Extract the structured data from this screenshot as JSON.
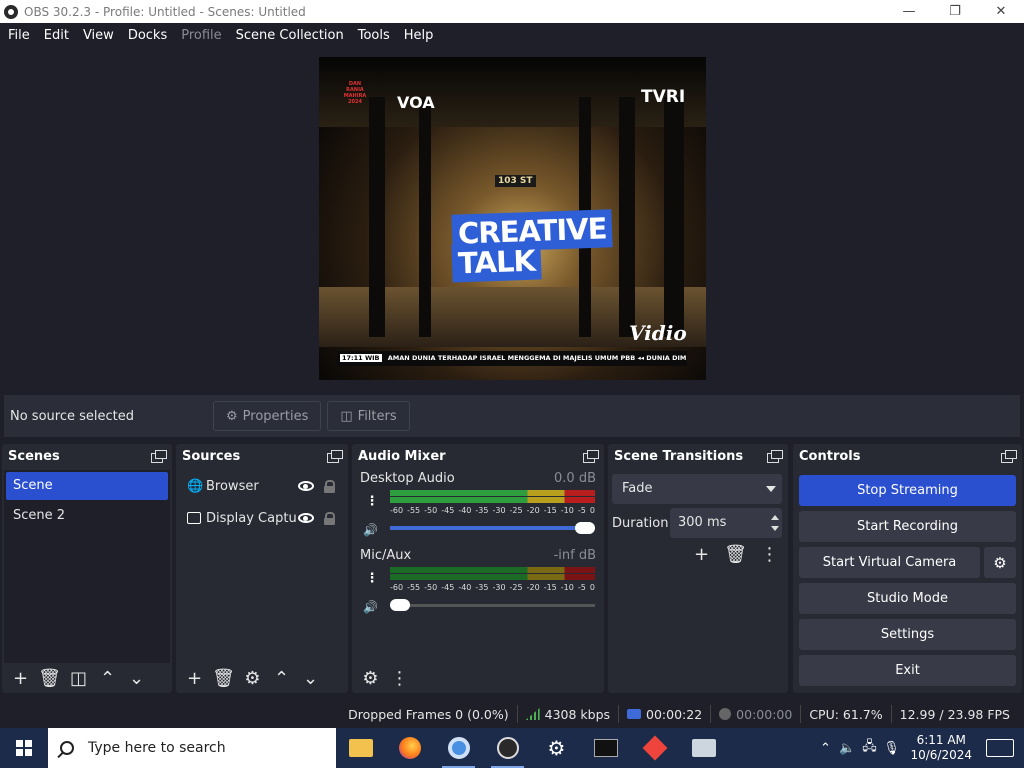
{
  "window": {
    "title": "OBS 30.2.3 - Profile: Untitled - Scenes: Untitled",
    "minimize": "—",
    "restore": "❐",
    "close": "✕"
  },
  "menu": [
    "File",
    "Edit",
    "View",
    "Docks",
    "Profile",
    "Scene Collection",
    "Tools",
    "Help"
  ],
  "preview": {
    "overlay_title_1": "CREATIVE",
    "overlay_title_2": "TALK",
    "logo_voa": "VOA",
    "logo_tvri": "TVRI",
    "logo_vidio": "Vidio",
    "sign_text": "103 ST",
    "ticker_time": "17:11 WIB",
    "ticker_text": "AMAN DUNIA TERHADAP ISRAEL MENGGEMA DI MAJELIS UMUM PBB  ◂◂  DUNIA DIM",
    "badge_lines": [
      "DAN",
      "RANIA",
      "MAHIRA",
      "2024"
    ]
  },
  "sourcebar": {
    "status": "No source selected",
    "properties": "Properties",
    "filters": "Filters"
  },
  "scenes": {
    "title": "Scenes",
    "items": [
      {
        "label": "Scene",
        "selected": true
      },
      {
        "label": "Scene 2",
        "selected": false
      }
    ]
  },
  "sources": {
    "title": "Sources",
    "items": [
      {
        "label": "Browser",
        "visible": true,
        "locked": false
      },
      {
        "label": "Display Captu",
        "visible": true,
        "locked": false
      }
    ]
  },
  "mixer": {
    "title": "Audio Mixer",
    "scale": [
      "-60",
      "-55",
      "-50",
      "-45",
      "-40",
      "-35",
      "-30",
      "-25",
      "-20",
      "-15",
      "-10",
      "-5",
      "0"
    ],
    "channels": [
      {
        "name": "Desktop Audio",
        "db": "0.0 dB",
        "volume": 1.0
      },
      {
        "name": "Mic/Aux",
        "db": "-inf dB",
        "volume": 0.0
      }
    ]
  },
  "transitions": {
    "title": "Scene Transitions",
    "selected": "Fade",
    "duration_label": "Duration",
    "duration_value": "300 ms"
  },
  "controls": {
    "title": "Controls",
    "stop_streaming": "Stop Streaming",
    "start_recording": "Start Recording",
    "start_virtual_camera": "Start Virtual Camera",
    "studio_mode": "Studio Mode",
    "settings": "Settings",
    "exit": "Exit"
  },
  "status": {
    "dropped_frames": "Dropped Frames 0 (0.0%)",
    "bitrate": "4308 kbps",
    "stream_time": "00:00:22",
    "record_time": "00:00:00",
    "cpu": "CPU: 61.7%",
    "fps": "12.99 / 23.98 FPS"
  },
  "taskbar": {
    "search_placeholder": "Type here to search",
    "time": "6:11 AM",
    "date": "10/6/2024"
  },
  "colors": {
    "accent": "#2a4fcf",
    "background": "#1e1f28",
    "dock": "#272a33"
  }
}
